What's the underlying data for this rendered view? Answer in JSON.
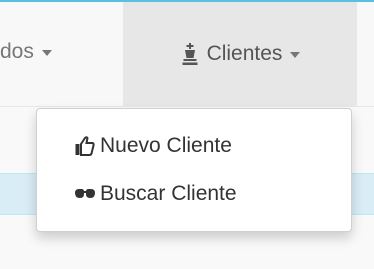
{
  "navbar": {
    "partial_item_label": "dos",
    "clientes_label": "Clientes",
    "clientes_icon": "chess-king-icon",
    "active_bg": "#e7e7e7",
    "accent": "#5bc0de"
  },
  "dropdown": {
    "items": [
      {
        "label": "Nuevo Cliente",
        "icon": "thumbs-up-icon"
      },
      {
        "label": "Buscar Cliente",
        "icon": "glasses-icon"
      }
    ]
  },
  "alert": {
    "color": "#d9edf7"
  }
}
